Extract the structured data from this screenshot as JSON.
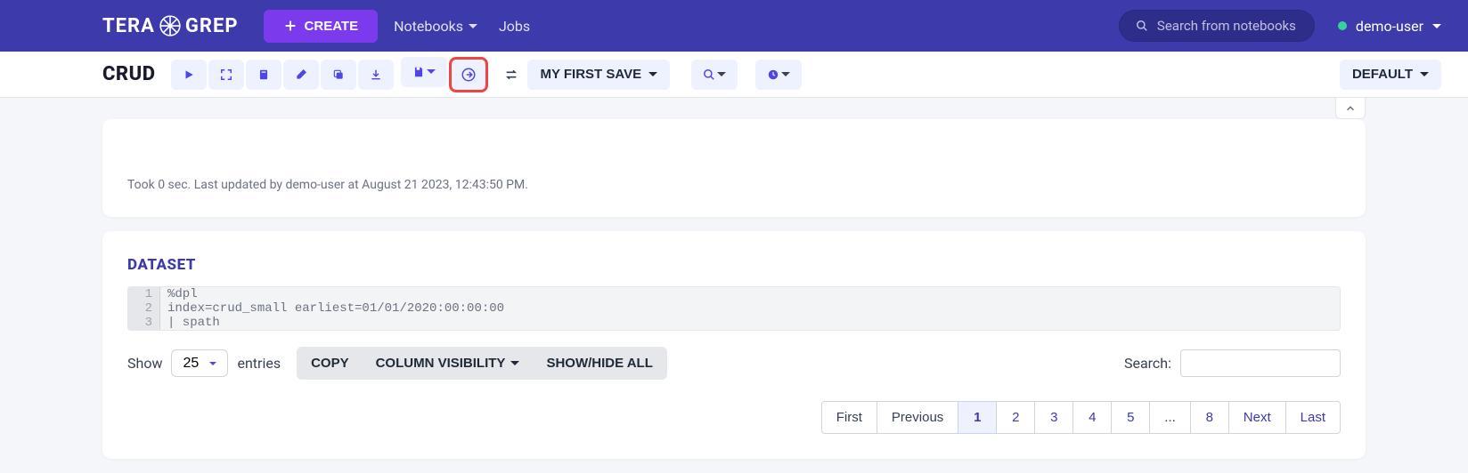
{
  "brand": {
    "left": "TERA",
    "right": "GREP"
  },
  "nav": {
    "create": "CREATE",
    "notebooks": "Notebooks",
    "jobs": "Jobs",
    "search_placeholder": "Search from notebooks",
    "user": "demo-user"
  },
  "toolbar": {
    "page_title": "CRUD",
    "save_name": "MY FIRST SAVE",
    "default_label": "DEFAULT"
  },
  "card1": {
    "status": "Took 0 sec. Last updated by demo-user at August 21 2023, 12:43:50 PM."
  },
  "dataset": {
    "title": "DATASET",
    "code": [
      {
        "n": "1",
        "t": "%dpl"
      },
      {
        "n": "2",
        "t": "index=crud_small earliest=01/01/2020:00:00:00"
      },
      {
        "n": "3",
        "t": "| spath"
      }
    ],
    "show": "Show",
    "entries_value": "25",
    "entries": "entries",
    "copy": "COPY",
    "colvis": "COLUMN VISIBILITY",
    "showhide": "SHOW/HIDE ALL",
    "search_label": "Search:"
  },
  "pagination": {
    "first": "First",
    "previous": "Previous",
    "pages": [
      "1",
      "2",
      "3",
      "4",
      "5",
      "...",
      "8"
    ],
    "active": "1",
    "next": "Next",
    "last": "Last"
  }
}
